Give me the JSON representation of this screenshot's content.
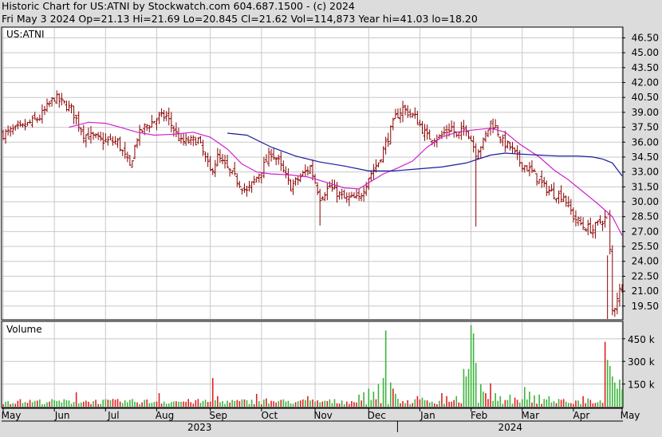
{
  "header": {
    "line1": "Historic Chart for US:ATNI by Stockwatch.com 604.687.1500 - (c) 2024",
    "line2": "Fri May  3 2024   Op=21.13  Hi=21.69  Lo=20.845  Cl=21.62  Vol=114,873  Year hi=41.03  lo=18.20"
  },
  "colors": {
    "background": "#dcdcdc",
    "panel": "#ffffff",
    "grid": "#c8c8c8",
    "price_bar": "#8b0000",
    "ma_short": "#d020d0",
    "ma_long": "#1a1aa0",
    "volume_up": "#3cb43c",
    "volume_down": "#e02020"
  },
  "chart_data": [
    {
      "type": "line",
      "title": "US:ATNI",
      "xlabel": "",
      "ylabel": "",
      "y_tick_labels": [
        "46.50",
        "45.00",
        "43.50",
        "42.00",
        "40.50",
        "39.00",
        "37.50",
        "36.00",
        "34.50",
        "33.00",
        "31.50",
        "30.00",
        "28.50",
        "27.00",
        "25.50",
        "24.00",
        "22.50",
        "21.00",
        "19.50"
      ],
      "ylim": [
        18.2,
        47.5
      ],
      "x_month_labels": [
        "May",
        "Jun",
        "Jul",
        "Aug",
        "Sep",
        "Oct",
        "Nov",
        "Dec",
        "Jan",
        "Feb",
        "Mar",
        "Apr",
        "May"
      ],
      "x_month_index": [
        0,
        21,
        42,
        63,
        85,
        106,
        128,
        150,
        171,
        192,
        213,
        234,
        254
      ],
      "x_year_labels": [
        "2023",
        "2024"
      ],
      "n_bars": 255,
      "price_anchors": {
        "x": [
          0,
          8,
          15,
          21,
          28,
          33,
          37,
          40,
          47,
          52,
          55,
          58,
          64,
          67,
          73,
          80,
          85,
          88,
          93,
          100,
          106,
          110,
          113,
          118,
          122,
          126,
          130,
          134,
          140,
          146,
          150,
          154,
          158,
          161,
          164,
          169,
          174,
          179,
          184,
          186,
          190,
          194,
          197,
          200,
          202,
          205,
          208,
          212,
          217,
          222,
          226,
          230,
          234,
          238,
          242,
          245,
          248,
          249,
          250,
          251,
          252,
          254
        ],
        "y": [
          36.8,
          37.5,
          38.5,
          40.5,
          39.3,
          36.8,
          36.5,
          36.2,
          36.0,
          33.5,
          36.5,
          37.5,
          38.5,
          38.6,
          36.0,
          36.2,
          33.0,
          34.5,
          33.0,
          31.0,
          33.2,
          35.0,
          34.0,
          31.5,
          32.5,
          33.5,
          30.5,
          31.5,
          30.3,
          30.3,
          32.5,
          34.0,
          36.5,
          38.5,
          39.4,
          38.5,
          36.5,
          36.5,
          37.5,
          36.5,
          37.5,
          35.0,
          36.0,
          38.0,
          37.5,
          36.0,
          35.5,
          34.0,
          33.0,
          31.5,
          30.8,
          30.6,
          28.5,
          27.5,
          27.2,
          28.0,
          28.5,
          25.0,
          19.0,
          19.5,
          20.5,
          21.62
        ]
      },
      "ma_short": {
        "x": [
          27,
          35,
          42,
          48,
          55,
          62,
          70,
          78,
          85,
          92,
          98,
          104,
          110,
          118,
          125,
          132,
          140,
          146,
          150,
          156,
          162,
          168,
          174,
          180,
          186,
          192,
          200,
          206,
          212,
          220,
          226,
          232,
          238,
          244,
          250,
          254
        ],
        "y": [
          37.5,
          38.0,
          37.9,
          37.5,
          37.0,
          36.7,
          36.8,
          37.0,
          36.5,
          35.3,
          33.8,
          33.0,
          32.8,
          32.7,
          32.5,
          32.0,
          31.4,
          31.3,
          31.9,
          32.8,
          33.4,
          34.1,
          35.5,
          36.5,
          37.0,
          37.2,
          37.4,
          37.0,
          35.8,
          34.5,
          33.2,
          32.2,
          31.0,
          29.8,
          28.5,
          26.6
        ]
      },
      "ma_long": {
        "x": [
          92,
          100,
          110,
          120,
          130,
          140,
          150,
          160,
          170,
          180,
          190,
          200,
          206,
          212,
          220,
          228,
          236,
          242,
          246,
          250,
          254
        ],
        "y": [
          36.9,
          36.7,
          35.5,
          34.6,
          34.0,
          33.6,
          33.1,
          33.1,
          33.3,
          33.5,
          33.9,
          34.7,
          34.9,
          34.8,
          34.7,
          34.6,
          34.6,
          34.5,
          34.3,
          33.9,
          32.6
        ]
      }
    },
    {
      "type": "bar",
      "title": "Volume",
      "y_tick_labels": [
        "450 k",
        "300 k",
        "150 k"
      ],
      "y_tick_values": [
        450000,
        300000,
        150000
      ],
      "ylim": [
        0,
        560000
      ],
      "avg_volume": 40000,
      "spikes": [
        {
          "x": 30,
          "value": 95000,
          "up": false
        },
        {
          "x": 64,
          "value": 90000,
          "up": false
        },
        {
          "x": 86,
          "value": 190000,
          "up": false
        },
        {
          "x": 88,
          "value": 70000,
          "up": false
        },
        {
          "x": 104,
          "value": 85000,
          "up": false
        },
        {
          "x": 108,
          "value": 55000,
          "up": false
        },
        {
          "x": 125,
          "value": 70000,
          "up": false
        },
        {
          "x": 146,
          "value": 80000,
          "up": true
        },
        {
          "x": 148,
          "value": 95000,
          "up": true
        },
        {
          "x": 150,
          "value": 120000,
          "up": true
        },
        {
          "x": 152,
          "value": 100000,
          "up": true
        },
        {
          "x": 154,
          "value": 150000,
          "up": true
        },
        {
          "x": 156,
          "value": 190000,
          "up": true
        },
        {
          "x": 157,
          "value": 505000,
          "up": true
        },
        {
          "x": 159,
          "value": 160000,
          "up": true
        },
        {
          "x": 160,
          "value": 120000,
          "up": false
        },
        {
          "x": 161,
          "value": 85000,
          "up": true
        },
        {
          "x": 170,
          "value": 70000,
          "up": false
        },
        {
          "x": 172,
          "value": 60000,
          "up": true
        },
        {
          "x": 180,
          "value": 90000,
          "up": false
        },
        {
          "x": 182,
          "value": 70000,
          "up": false
        },
        {
          "x": 186,
          "value": 70000,
          "up": true
        },
        {
          "x": 189,
          "value": 250000,
          "up": true
        },
        {
          "x": 190,
          "value": 200000,
          "up": true
        },
        {
          "x": 191,
          "value": 250000,
          "up": true
        },
        {
          "x": 192,
          "value": 540000,
          "up": true
        },
        {
          "x": 193,
          "value": 485000,
          "up": true
        },
        {
          "x": 194,
          "value": 290000,
          "up": true
        },
        {
          "x": 196,
          "value": 150000,
          "up": true
        },
        {
          "x": 197,
          "value": 100000,
          "up": true
        },
        {
          "x": 198,
          "value": 90000,
          "up": false
        },
        {
          "x": 200,
          "value": 155000,
          "up": false
        },
        {
          "x": 202,
          "value": 90000,
          "up": true
        },
        {
          "x": 204,
          "value": 70000,
          "up": true
        },
        {
          "x": 208,
          "value": 80000,
          "up": true
        },
        {
          "x": 210,
          "value": 60000,
          "up": false
        },
        {
          "x": 214,
          "value": 130000,
          "up": true
        },
        {
          "x": 216,
          "value": 100000,
          "up": true
        },
        {
          "x": 218,
          "value": 75000,
          "up": true
        },
        {
          "x": 220,
          "value": 80000,
          "up": true
        },
        {
          "x": 224,
          "value": 70000,
          "up": true
        },
        {
          "x": 238,
          "value": 70000,
          "up": false
        },
        {
          "x": 240,
          "value": 55000,
          "up": true
        },
        {
          "x": 247,
          "value": 430000,
          "up": false
        },
        {
          "x": 248,
          "value": 310000,
          "up": true
        },
        {
          "x": 249,
          "value": 270000,
          "up": true
        },
        {
          "x": 250,
          "value": 200000,
          "up": true
        },
        {
          "x": 251,
          "value": 160000,
          "up": true
        },
        {
          "x": 252,
          "value": 120000,
          "up": true
        },
        {
          "x": 253,
          "value": 180000,
          "up": true
        },
        {
          "x": 254,
          "value": 114873,
          "up": true
        }
      ]
    }
  ]
}
